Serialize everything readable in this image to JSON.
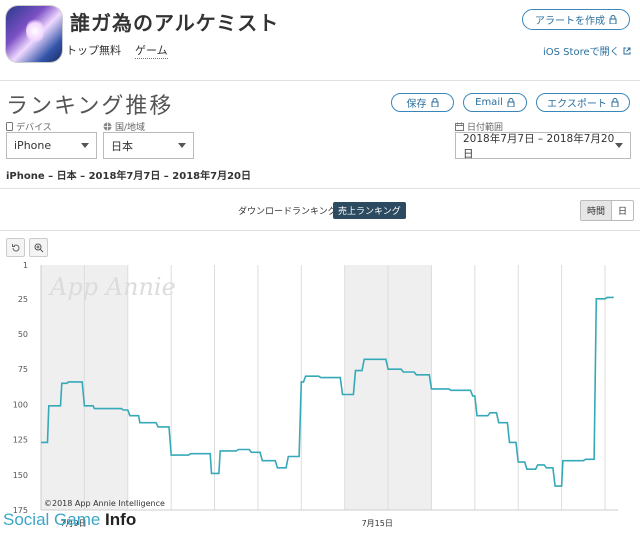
{
  "header": {
    "app_title": "誰ガ為のアルケミスト",
    "chart_category": "トップ無料",
    "genre": "ゲーム",
    "create_alert_label": "アラートを作成",
    "ios_store_label": "iOS Storeで開く"
  },
  "section": {
    "title": "ランキング推移",
    "save_label": "保存",
    "email_label": "Email",
    "export_label": "エクスポート"
  },
  "filters": {
    "device_label": "デバイス",
    "device_value": "iPhone",
    "country_label": "国/地域",
    "country_value": "日本",
    "date_label": "日付範囲",
    "date_value": "2018年7月7日 – 2018年7月20日"
  },
  "summary": "iPhone – 日本 – 2018年7月7日 – 2018年7月20日",
  "tabs": {
    "download_label": "ダウンロードランキング",
    "sales_label": "売上ランキング"
  },
  "granularity": {
    "hour_label": "時間",
    "day_label": "日"
  },
  "watermark": {
    "social": "Social Game ",
    "info": "Info"
  },
  "chart_data": {
    "type": "line",
    "y_ticks": [
      "1",
      "25",
      "50",
      "75",
      "100",
      "125",
      "150",
      "175"
    ],
    "ylim": [
      1,
      175
    ],
    "y_inverted": true,
    "x_range_days": [
      0,
      13.3
    ],
    "x_tick_labels": [
      {
        "day": 0.75,
        "label": "7月9日"
      },
      {
        "day": 7.75,
        "label": "7月15日"
      }
    ],
    "weekend_bands": [
      [
        0,
        2
      ],
      [
        7,
        9
      ]
    ],
    "watermark_text": "App Annie",
    "copyright": "©2018 App Annie Intelligence",
    "line_color": "#36a9b8",
    "series": [
      {
        "points": [
          [
            0.0,
            127
          ],
          [
            0.15,
            127
          ],
          [
            0.18,
            101
          ],
          [
            0.45,
            101
          ],
          [
            0.48,
            85
          ],
          [
            0.6,
            85
          ],
          [
            0.63,
            84
          ],
          [
            0.95,
            84
          ],
          [
            1.0,
            101
          ],
          [
            1.2,
            101
          ],
          [
            1.23,
            103
          ],
          [
            1.85,
            103
          ],
          [
            1.9,
            104
          ],
          [
            2.0,
            104
          ],
          [
            2.05,
            108
          ],
          [
            2.25,
            108
          ],
          [
            2.28,
            113
          ],
          [
            2.65,
            113
          ],
          [
            2.7,
            116
          ],
          [
            2.95,
            116
          ],
          [
            3.0,
            136
          ],
          [
            3.4,
            136
          ],
          [
            3.45,
            135
          ],
          [
            3.9,
            135
          ],
          [
            3.93,
            149
          ],
          [
            4.1,
            149
          ],
          [
            4.13,
            133
          ],
          [
            4.5,
            133
          ],
          [
            4.55,
            132
          ],
          [
            4.8,
            132
          ],
          [
            4.85,
            134
          ],
          [
            5.05,
            134
          ],
          [
            5.1,
            140
          ],
          [
            5.4,
            140
          ],
          [
            5.45,
            145
          ],
          [
            5.65,
            145
          ],
          [
            5.7,
            137
          ],
          [
            5.95,
            137
          ],
          [
            6.0,
            84
          ],
          [
            6.05,
            84
          ],
          [
            6.1,
            80
          ],
          [
            6.4,
            80
          ],
          [
            6.45,
            81
          ],
          [
            6.9,
            81
          ],
          [
            6.95,
            93
          ],
          [
            7.2,
            93
          ],
          [
            7.25,
            76
          ],
          [
            7.4,
            76
          ],
          [
            7.45,
            68
          ],
          [
            7.95,
            68
          ],
          [
            8.0,
            75
          ],
          [
            8.3,
            75
          ],
          [
            8.35,
            77
          ],
          [
            8.6,
            77
          ],
          [
            8.65,
            79
          ],
          [
            8.95,
            79
          ],
          [
            9.0,
            89
          ],
          [
            9.4,
            89
          ],
          [
            9.45,
            90
          ],
          [
            9.9,
            90
          ],
          [
            9.95,
            94
          ],
          [
            10.0,
            94
          ],
          [
            10.05,
            108
          ],
          [
            10.3,
            108
          ],
          [
            10.35,
            106
          ],
          [
            10.5,
            106
          ],
          [
            10.55,
            113
          ],
          [
            10.75,
            113
          ],
          [
            10.8,
            127
          ],
          [
            10.95,
            127
          ],
          [
            11.0,
            141
          ],
          [
            11.15,
            141
          ],
          [
            11.2,
            146
          ],
          [
            11.4,
            146
          ],
          [
            11.45,
            143
          ],
          [
            11.6,
            143
          ],
          [
            11.65,
            145
          ],
          [
            11.8,
            145
          ],
          [
            11.85,
            158
          ],
          [
            12.0,
            158
          ],
          [
            12.03,
            140
          ],
          [
            12.5,
            140
          ],
          [
            12.55,
            139
          ],
          [
            12.75,
            139
          ],
          [
            12.8,
            25
          ],
          [
            13.0,
            25
          ],
          [
            13.05,
            24
          ],
          [
            13.2,
            24
          ]
        ]
      }
    ]
  }
}
